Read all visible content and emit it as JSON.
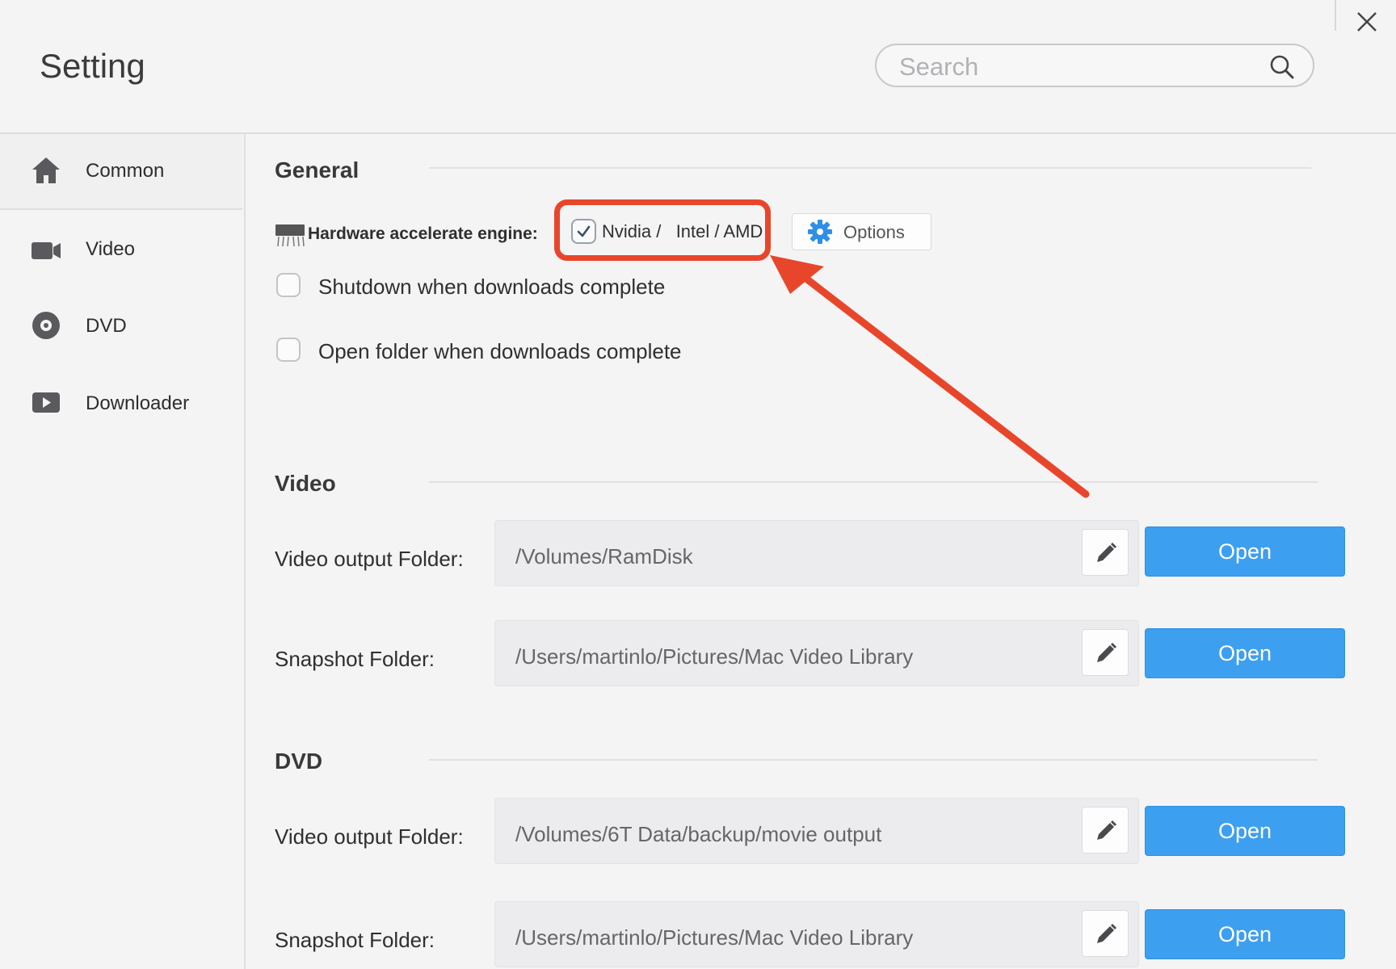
{
  "window": {
    "title": "Setting"
  },
  "search": {
    "placeholder": "Search"
  },
  "sidebar": {
    "items": [
      {
        "label": "Common",
        "icon": "home-icon"
      },
      {
        "label": "Video",
        "icon": "video-camera-icon"
      },
      {
        "label": "DVD",
        "icon": "disc-icon"
      },
      {
        "label": "Downloader",
        "icon": "play-icon"
      }
    ]
  },
  "general": {
    "title": "General",
    "hardware_label": "Hardware accelerate engine:",
    "hardware_checked": true,
    "hardware_option": "Nvidia /   Intel / AMD",
    "options_label": "Options",
    "shutdown_label": "Shutdown when downloads complete",
    "shutdown_checked": false,
    "open_folder_label": "Open folder when downloads complete",
    "open_folder_checked": false
  },
  "video": {
    "title": "Video",
    "output_label": "Video output Folder:",
    "output_path": "/Volumes/RamDisk",
    "snapshot_label": "Snapshot Folder:",
    "snapshot_path": "/Users/martinlo/Pictures/Mac Video Library",
    "open_label": "Open"
  },
  "dvd": {
    "title": "DVD",
    "output_label": "Video output Folder:",
    "output_path": "/Volumes/6T Data/backup/movie output",
    "snapshot_label": "Snapshot Folder:",
    "snapshot_path": "/Users/martinlo/Pictures/Mac Video Library",
    "open_label": "Open"
  },
  "colors": {
    "accent_blue": "#3d9ff0",
    "annotation_red": "#e8462a"
  }
}
